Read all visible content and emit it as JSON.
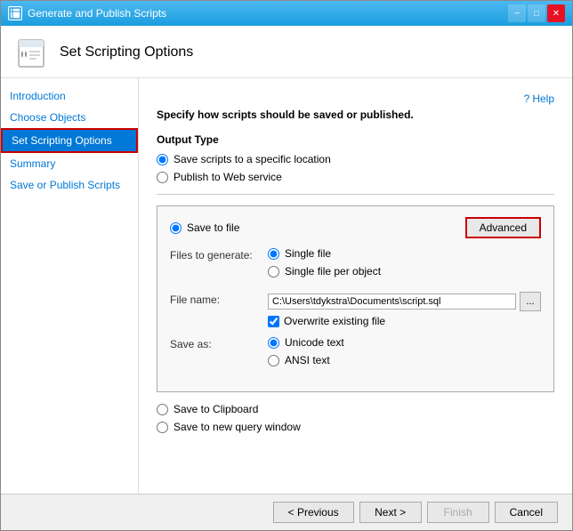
{
  "window": {
    "title": "Generate and Publish Scripts",
    "minimize_label": "−",
    "maximize_label": "□",
    "close_label": "✕"
  },
  "header": {
    "title": "Set Scripting Options",
    "help_label": "Help"
  },
  "sidebar": {
    "items": [
      {
        "id": "introduction",
        "label": "Introduction",
        "active": false
      },
      {
        "id": "choose-objects",
        "label": "Choose Objects",
        "active": false
      },
      {
        "id": "set-scripting-options",
        "label": "Set Scripting Options",
        "active": true
      },
      {
        "id": "summary",
        "label": "Summary",
        "active": false
      },
      {
        "id": "save-or-publish",
        "label": "Save or Publish Scripts",
        "active": false
      }
    ]
  },
  "main": {
    "instruction": "Specify how scripts should be saved or published.",
    "output_type_label": "Output Type",
    "output_type_options": [
      {
        "id": "save-to-location",
        "label": "Save scripts to a specific location",
        "checked": true
      },
      {
        "id": "publish-web",
        "label": "Publish to Web service",
        "checked": false
      }
    ],
    "save_to_file_radio_label": "Save to file",
    "save_to_file_checked": true,
    "advanced_button_label": "Advanced",
    "files_to_generate_label": "Files to generate:",
    "files_options": [
      {
        "id": "single-file",
        "label": "Single file",
        "checked": true
      },
      {
        "id": "single-file-per-object",
        "label": "Single file per object",
        "checked": false
      }
    ],
    "file_name_label": "File name:",
    "file_name_value": "C:\\Users\\tdykstra\\Documents\\script.sql",
    "browse_label": "...",
    "overwrite_label": "Overwrite existing file",
    "overwrite_checked": true,
    "save_as_label": "Save as:",
    "save_as_options": [
      {
        "id": "unicode",
        "label": "Unicode text",
        "checked": true
      },
      {
        "id": "ansi",
        "label": "ANSI text",
        "checked": false
      }
    ],
    "save_to_clipboard_label": "Save to Clipboard",
    "save_to_clipboard_checked": false,
    "save_to_query_label": "Save to new query window",
    "save_to_query_checked": false
  },
  "footer": {
    "previous_label": "< Previous",
    "next_label": "Next >",
    "finish_label": "Finish",
    "cancel_label": "Cancel"
  }
}
